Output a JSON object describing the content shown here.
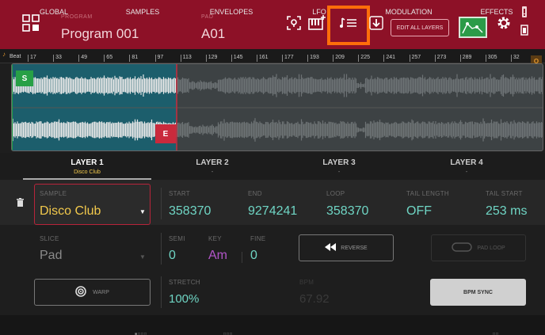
{
  "header": {
    "program_label": "PROGRAM",
    "program_value": "Program 001",
    "pad_label": "PAD",
    "pad_value": "A01",
    "edit_all_label": "EDIT ALL LAYERS",
    "icons": [
      "grid-menu-icon",
      "locate-pad-icon",
      "keyboard-plus-icon",
      "note-list-icon",
      "download-icon",
      "envelope-icon",
      "gear-icon",
      "battery-alert-icon"
    ],
    "accent_color": "#8d1127",
    "highlight_color": "#ff6e0a"
  },
  "ruler": {
    "beat_label": "Beat",
    "ticks": [
      "17",
      "33",
      "49",
      "65",
      "81",
      "97",
      "113",
      "129",
      "145",
      "161",
      "177",
      "193",
      "209",
      "225",
      "241",
      "257",
      "273",
      "289",
      "305",
      "32"
    ],
    "q_label": "Q"
  },
  "waveform": {
    "start_marker": "S",
    "end_marker": "E"
  },
  "layers": [
    {
      "name": "LAYER 1",
      "sub": "Disco Club"
    },
    {
      "name": "LAYER 2",
      "sub": "-"
    },
    {
      "name": "LAYER 3",
      "sub": "-"
    },
    {
      "name": "LAYER 4",
      "sub": "-"
    }
  ],
  "sample_row": {
    "sample_label": "SAMPLE",
    "sample_value": "Disco Club",
    "start_label": "START",
    "start_value": "358370",
    "end_label": "END",
    "end_value": "9274241",
    "loop_label": "LOOP",
    "loop_value": "358370",
    "tail_length_label": "TAIL LENGTH",
    "tail_length_value": "OFF",
    "tail_start_label": "TAIL START",
    "tail_start_value": "253 ms"
  },
  "row2": {
    "slice_label": "SLICE",
    "slice_value": "Pad",
    "semi_label": "SEMI",
    "semi_value": "0",
    "key_label": "KEY",
    "key_value": "Am",
    "fine_label": "FINE",
    "fine_value": "0",
    "reverse_label": "REVERSE",
    "pad_loop_label": "PAD LOOP"
  },
  "row3": {
    "warp_label": "WARP",
    "stretch_label": "STRETCH",
    "stretch_value": "100%",
    "bpm_label": "BPM",
    "bpm_value": "67.92",
    "bpm_sync_label": "BPM SYNC"
  },
  "bottom_tabs": [
    "GLOBAL",
    "SAMPLES",
    "ENVELOPES",
    "LFO",
    "MODULATION",
    "EFFECTS"
  ]
}
